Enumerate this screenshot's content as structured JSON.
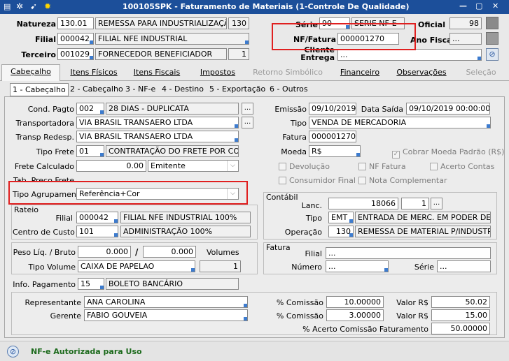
{
  "window": {
    "title": "100105SPK - Faturamento de Materiais (1-Controle De Qualidade)",
    "controls": [
      "—",
      "▢",
      "✕"
    ]
  },
  "header": {
    "natureza": {
      "label": "Natureza",
      "code": "130.01",
      "desc": "REMESSA PARA INDUSTRIALIZAÇÃO",
      "num": "130"
    },
    "filial": {
      "label": "Filial",
      "code": "000042",
      "desc": "FILIAL NFE INDUSTRIAL"
    },
    "terceiro": {
      "label": "Terceiro",
      "code": "001029",
      "desc": "FORNECEDOR BENEFICIADOR",
      "num": "1"
    },
    "serie": {
      "label": "Série",
      "value": "90",
      "desc": "SERIE NF-E"
    },
    "oficial": {
      "label": "Oficial",
      "value": "98"
    },
    "nf_fatura": {
      "label": "NF/Fatura",
      "value": "000001270"
    },
    "ano_fiscal": {
      "label": "Ano Fiscal",
      "value": "..."
    },
    "cliente_entrega": {
      "label1": "Cliente",
      "label2": "Entrega",
      "value": "..."
    }
  },
  "tabs": [
    {
      "label": "Cabeçalho",
      "state": "sel"
    },
    {
      "label": "Itens Físicos",
      "state": ""
    },
    {
      "label": "Itens Fiscais",
      "state": ""
    },
    {
      "label": "Impostos",
      "state": ""
    },
    {
      "label": "Retorno Simbólico",
      "state": "dis"
    },
    {
      "label": "Financeiro",
      "state": ""
    },
    {
      "label": "Observações",
      "state": ""
    },
    {
      "label": "Seleção",
      "state": "dis"
    }
  ],
  "subtabs": [
    "1 - Cabeçalho",
    "2 - Cabeçalho",
    "3 - NF-e",
    "4 - Destino",
    "5 - Exportação",
    "6 - Outros"
  ],
  "left": {
    "cond_pagto": {
      "label": "Cond. Pagto",
      "code": "002",
      "desc": "28 DIAS - DUPLICATA"
    },
    "transportadora": {
      "label": "Transportadora",
      "value": "VIA BRASIL TRANSAERO LTDA"
    },
    "transp_redesp": {
      "label": "Transp Redesp.",
      "value": "VIA BRASIL TRANSAERO LTDA"
    },
    "tipo_frete": {
      "label": "Tipo Frete",
      "code": "01",
      "desc": "CONTRATAÇÃO DO FRETE POR CONTA"
    },
    "frete_calculado": {
      "label": "Frete Calculado",
      "value": "0.00",
      "option": "Emitente"
    },
    "tab_preco_frete": {
      "label": "Tab. Preço Frete"
    },
    "tipo_agrupamento": {
      "label": "Tipo Agrupamento",
      "value": "Referência+Cor"
    }
  },
  "right": {
    "emissao": {
      "label": "Emissão",
      "value": "09/10/2019"
    },
    "data_saida": {
      "label": "Data Saída",
      "value": "09/10/2019 00:00:00"
    },
    "tipo": {
      "label": "Tipo",
      "value": "VENDA DE MERCADORIA"
    },
    "fatura": {
      "label": "Fatura",
      "value": "000001270"
    },
    "moeda": {
      "label": "Moeda",
      "value": "R$"
    },
    "cobrar_moeda": "Cobrar Moeda Padrão (R$)",
    "devolucao": "Devolução",
    "nf_fatura_chk": "NF Fatura",
    "acerto_contas": "Acerto Contas",
    "consumidor_final": "Consumidor Final",
    "nota_complementar": "Nota Complementar"
  },
  "rateio": {
    "title": "Rateio",
    "filial": {
      "label": "Filial",
      "code": "000042",
      "desc": "FILIAL NFE INDUSTRIAL 100%"
    },
    "centro": {
      "label": "Centro de Custo",
      "code": "101",
      "desc": "ADMINISTRAÇÃO 100%"
    }
  },
  "contabil": {
    "title": "Contábil",
    "lanc": {
      "label": "Lanc.",
      "value": "18066",
      "seq": "1"
    },
    "tipo": {
      "label": "Tipo",
      "code": "EMT",
      "desc": "ENTRADA DE MERC. EM PODER DE TERCEIRO"
    },
    "operacao": {
      "label": "Operação",
      "code": "130",
      "desc": "REMESSA DE MATERIAL P/INDUSTRIALIZAÇÃO"
    }
  },
  "peso": {
    "label": "Peso Líq. / Bruto",
    "liq": "0.000",
    "sep": "/",
    "bruto": "0.000",
    "volumes_label": "Volumes",
    "tipo_volume_label": "Tipo Volume",
    "tipo_volume": "CAIXA DE PAPELAO",
    "volumes": "1"
  },
  "fatura_panel": {
    "title": "Fatura",
    "filial_label": "Filial",
    "filial": "...",
    "numero_label": "Número",
    "numero": "...",
    "serie_label": "Série",
    "serie": "..."
  },
  "info_pagamento": {
    "label": "Info. Pagamento",
    "code": "15",
    "desc": "BOLETO BANCÁRIO"
  },
  "comissao": {
    "representante": {
      "label": "Representante",
      "value": "ANA CAROLINA",
      "pct_label": "% Comissão",
      "pct": "10.00000",
      "valor_label": "Valor R$",
      "valor": "50.02"
    },
    "gerente": {
      "label": "Gerente",
      "value": "FABIO GOUVEIA",
      "pct_label": "% Comissão",
      "pct": "3.00000",
      "valor_label": "Valor R$",
      "valor": "15.00"
    },
    "acerto": {
      "label": "% Acerto Comissão Faturamento",
      "value": "50.00000"
    }
  },
  "status": {
    "text": "NF-e Autorizada para Uso"
  },
  "colors": {
    "titlebar": "#1c4f9a",
    "status_text": "#1c6a1c",
    "highlight": "#e02020"
  }
}
